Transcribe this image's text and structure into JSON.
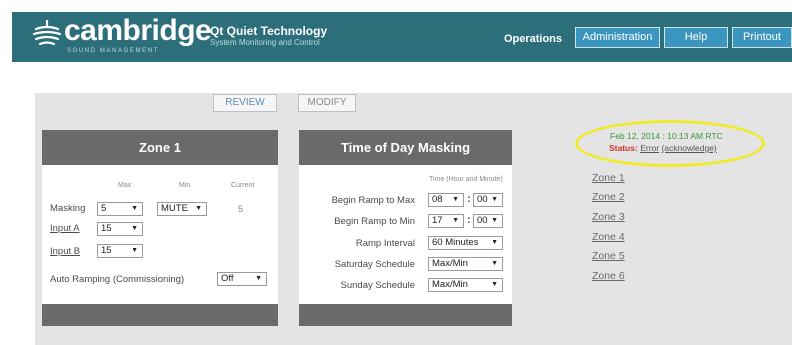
{
  "brand": {
    "logo_word": "cambridge",
    "logo_sub": "SOUND MANAGEMENT",
    "product_name": "Qt Quiet Technology",
    "product_sub": "System Monitoring and Control"
  },
  "tabs": [
    {
      "label": "Operations",
      "active": true
    },
    {
      "label": "Administration",
      "active": false
    },
    {
      "label": "Help",
      "active": false
    },
    {
      "label": "Printout",
      "active": false
    }
  ],
  "mode": {
    "review_label": "REVIEW",
    "modify_label": "MODIFY"
  },
  "zone_panel": {
    "title": "Zone 1",
    "col_max": "Max",
    "col_min": "Min",
    "col_current": "Current",
    "masking": {
      "label": "Masking",
      "max": "5",
      "min": "MUTE",
      "current": "5"
    },
    "input_a": {
      "label": "Input A",
      "value": "15"
    },
    "input_b": {
      "label": "Input B",
      "value": "15"
    },
    "auto_ramping": {
      "label": "Auto Ramping (Commissioning)",
      "value": "Off"
    }
  },
  "tod_panel": {
    "title": "Time of Day Masking",
    "time_hint": "Time (Hour and Minute)",
    "begin_max": {
      "label": "Begin Ramp to Max",
      "hour": "08",
      "minute": "00"
    },
    "begin_min": {
      "label": "Begin Ramp to Min",
      "hour": "17",
      "minute": "00"
    },
    "ramp_interval": {
      "label": "Ramp Interval",
      "value": "60 Minutes"
    },
    "saturday": {
      "label": "Saturday Schedule",
      "value": "Max/Min"
    },
    "sunday": {
      "label": "Sunday Schedule",
      "value": "Max/Min"
    }
  },
  "status": {
    "datetime": "Feb 12, 2014 : 10:13 AM RTC",
    "status_key": "Status:",
    "status_value": "Error",
    "acknowledge": "(acknowledge)"
  },
  "zones": [
    "Zone 1",
    "Zone 2",
    "Zone 3",
    "Zone 4",
    "Zone 5",
    "Zone 6"
  ],
  "colors": {
    "header": "#2c6f7a",
    "tab_button": "#3a95bf",
    "panel_head": "#6a6a6a",
    "highlight": "#f0ea2a",
    "error": "#d2342c",
    "ok_green": "#3a9a3a"
  }
}
